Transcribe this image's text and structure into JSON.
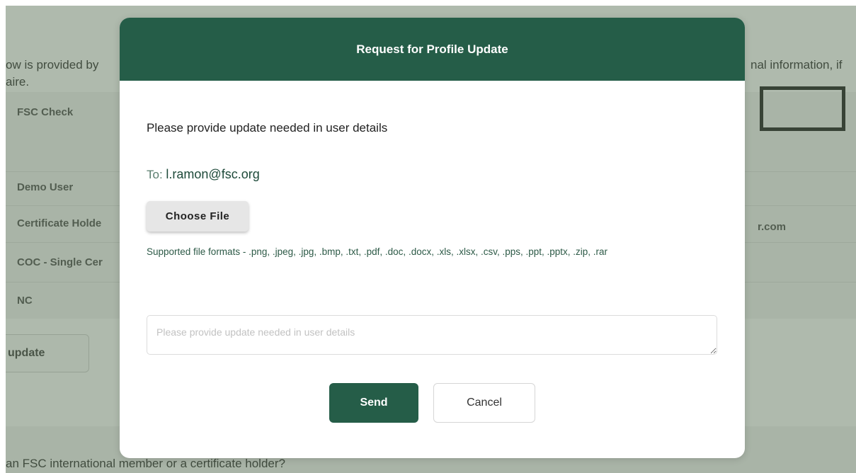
{
  "background": {
    "intro_line1_left": "ow is provided by",
    "intro_line1_right": "nal information, if",
    "intro_line2": "aire.",
    "labels": [
      "FSC Check",
      "Demo User",
      "Certificate Holde",
      "COC - Single Cer",
      "NC"
    ],
    "email_fragment": "r.com",
    "update_button": "update",
    "bottom_question": "an FSC international member or a certificate holder?"
  },
  "modal": {
    "title": "Request for Profile Update",
    "instruction": "Please provide update needed in user details",
    "to_label": "To: ",
    "to_email": "l.ramon@fsc.org",
    "choose_file_label": "Choose File",
    "supported_formats": "Supported file formats - .png, .jpeg, .jpg, .bmp, .txt, .pdf, .doc, .docx, .xls, .xlsx, .csv, .pps, .ppt, .pptx, .zip, .rar",
    "textarea_placeholder": "Please provide update needed in user details",
    "textarea_value": "",
    "send_label": "Send",
    "cancel_label": "Cancel"
  },
  "colors": {
    "header_green": "#255d48",
    "overlay": "#60765c"
  }
}
